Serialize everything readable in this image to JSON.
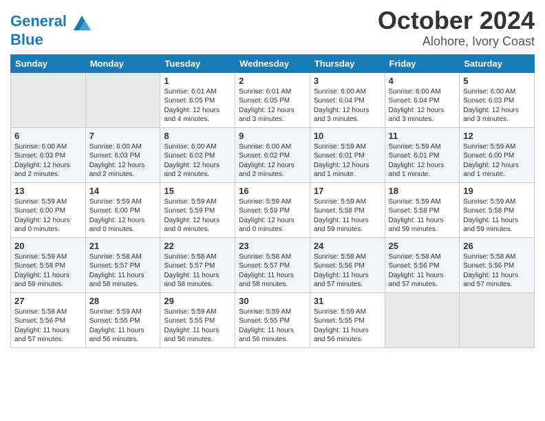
{
  "header": {
    "logo_line1": "General",
    "logo_line2": "Blue",
    "month": "October 2024",
    "location": "Alohore, Ivory Coast"
  },
  "weekdays": [
    "Sunday",
    "Monday",
    "Tuesday",
    "Wednesday",
    "Thursday",
    "Friday",
    "Saturday"
  ],
  "weeks": [
    [
      {
        "day": "",
        "empty": true
      },
      {
        "day": "",
        "empty": true
      },
      {
        "day": "1",
        "sunrise": "6:01 AM",
        "sunset": "6:05 PM",
        "daylight": "12 hours and 4 minutes."
      },
      {
        "day": "2",
        "sunrise": "6:01 AM",
        "sunset": "6:05 PM",
        "daylight": "12 hours and 3 minutes."
      },
      {
        "day": "3",
        "sunrise": "6:00 AM",
        "sunset": "6:04 PM",
        "daylight": "12 hours and 3 minutes."
      },
      {
        "day": "4",
        "sunrise": "6:00 AM",
        "sunset": "6:04 PM",
        "daylight": "12 hours and 3 minutes."
      },
      {
        "day": "5",
        "sunrise": "6:00 AM",
        "sunset": "6:03 PM",
        "daylight": "12 hours and 3 minutes."
      }
    ],
    [
      {
        "day": "6",
        "sunrise": "6:00 AM",
        "sunset": "6:03 PM",
        "daylight": "12 hours and 2 minutes."
      },
      {
        "day": "7",
        "sunrise": "6:00 AM",
        "sunset": "6:03 PM",
        "daylight": "12 hours and 2 minutes."
      },
      {
        "day": "8",
        "sunrise": "6:00 AM",
        "sunset": "6:02 PM",
        "daylight": "12 hours and 2 minutes."
      },
      {
        "day": "9",
        "sunrise": "6:00 AM",
        "sunset": "6:02 PM",
        "daylight": "12 hours and 2 minutes."
      },
      {
        "day": "10",
        "sunrise": "5:59 AM",
        "sunset": "6:01 PM",
        "daylight": "12 hours and 1 minute."
      },
      {
        "day": "11",
        "sunrise": "5:59 AM",
        "sunset": "6:01 PM",
        "daylight": "12 hours and 1 minute."
      },
      {
        "day": "12",
        "sunrise": "5:59 AM",
        "sunset": "6:00 PM",
        "daylight": "12 hours and 1 minute."
      }
    ],
    [
      {
        "day": "13",
        "sunrise": "5:59 AM",
        "sunset": "6:00 PM",
        "daylight": "12 hours and 0 minutes."
      },
      {
        "day": "14",
        "sunrise": "5:59 AM",
        "sunset": "6:00 PM",
        "daylight": "12 hours and 0 minutes."
      },
      {
        "day": "15",
        "sunrise": "5:59 AM",
        "sunset": "5:59 PM",
        "daylight": "12 hours and 0 minutes."
      },
      {
        "day": "16",
        "sunrise": "5:59 AM",
        "sunset": "5:59 PM",
        "daylight": "12 hours and 0 minutes."
      },
      {
        "day": "17",
        "sunrise": "5:59 AM",
        "sunset": "5:58 PM",
        "daylight": "11 hours and 59 minutes."
      },
      {
        "day": "18",
        "sunrise": "5:59 AM",
        "sunset": "5:58 PM",
        "daylight": "11 hours and 59 minutes."
      },
      {
        "day": "19",
        "sunrise": "5:59 AM",
        "sunset": "5:58 PM",
        "daylight": "11 hours and 59 minutes."
      }
    ],
    [
      {
        "day": "20",
        "sunrise": "5:59 AM",
        "sunset": "5:58 PM",
        "daylight": "11 hours and 59 minutes."
      },
      {
        "day": "21",
        "sunrise": "5:58 AM",
        "sunset": "5:57 PM",
        "daylight": "11 hours and 58 minutes."
      },
      {
        "day": "22",
        "sunrise": "5:58 AM",
        "sunset": "5:57 PM",
        "daylight": "11 hours and 58 minutes."
      },
      {
        "day": "23",
        "sunrise": "5:58 AM",
        "sunset": "5:57 PM",
        "daylight": "11 hours and 58 minutes."
      },
      {
        "day": "24",
        "sunrise": "5:58 AM",
        "sunset": "5:56 PM",
        "daylight": "11 hours and 57 minutes."
      },
      {
        "day": "25",
        "sunrise": "5:58 AM",
        "sunset": "5:56 PM",
        "daylight": "11 hours and 57 minutes."
      },
      {
        "day": "26",
        "sunrise": "5:58 AM",
        "sunset": "5:56 PM",
        "daylight": "11 hours and 57 minutes."
      }
    ],
    [
      {
        "day": "27",
        "sunrise": "5:58 AM",
        "sunset": "5:56 PM",
        "daylight": "11 hours and 57 minutes."
      },
      {
        "day": "28",
        "sunrise": "5:59 AM",
        "sunset": "5:55 PM",
        "daylight": "11 hours and 56 minutes."
      },
      {
        "day": "29",
        "sunrise": "5:59 AM",
        "sunset": "5:55 PM",
        "daylight": "11 hours and 56 minutes."
      },
      {
        "day": "30",
        "sunrise": "5:59 AM",
        "sunset": "5:55 PM",
        "daylight": "11 hours and 56 minutes."
      },
      {
        "day": "31",
        "sunrise": "5:59 AM",
        "sunset": "5:55 PM",
        "daylight": "11 hours and 56 minutes."
      },
      {
        "day": "",
        "empty": true
      },
      {
        "day": "",
        "empty": true
      }
    ]
  ]
}
